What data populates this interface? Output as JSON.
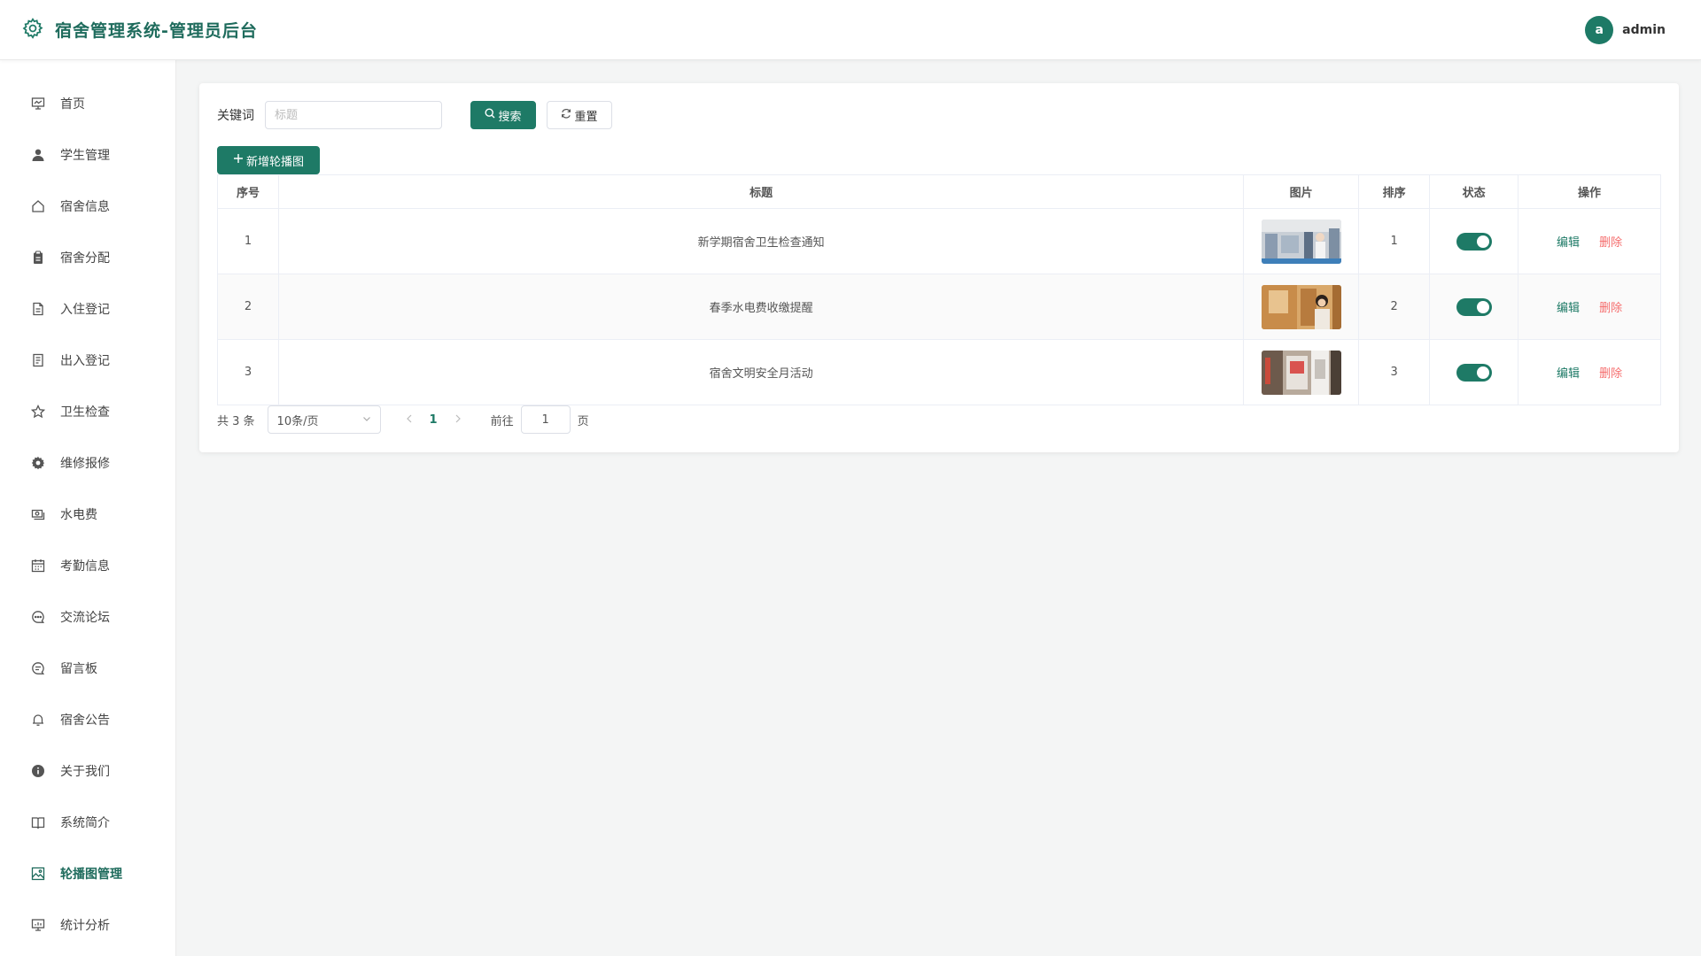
{
  "header": {
    "title": "宿舍管理系统-管理员后台",
    "avatar_letter": "a",
    "username": "admin"
  },
  "sidebar": {
    "items": [
      {
        "label": "首页",
        "icon": "presentation-icon"
      },
      {
        "label": "学生管理",
        "icon": "user-icon"
      },
      {
        "label": "宿舍信息",
        "icon": "home-icon"
      },
      {
        "label": "宿舍分配",
        "icon": "clipboard-icon"
      },
      {
        "label": "入住登记",
        "icon": "document-icon"
      },
      {
        "label": "出入登记",
        "icon": "tickets-icon"
      },
      {
        "label": "卫生检查",
        "icon": "star-icon"
      },
      {
        "label": "维修报修",
        "icon": "gear-icon"
      },
      {
        "label": "水电费",
        "icon": "money-icon"
      },
      {
        "label": "考勤信息",
        "icon": "calendar-icon"
      },
      {
        "label": "交流论坛",
        "icon": "chat-dots-icon"
      },
      {
        "label": "留言板",
        "icon": "chat-icon"
      },
      {
        "label": "宿舍公告",
        "icon": "bell-icon"
      },
      {
        "label": "关于我们",
        "icon": "info-icon"
      },
      {
        "label": "系统简介",
        "icon": "book-icon"
      },
      {
        "label": "轮播图管理",
        "icon": "picture-icon",
        "active": true
      },
      {
        "label": "统计分析",
        "icon": "data-board-icon"
      }
    ]
  },
  "search": {
    "label": "关键词",
    "placeholder": "标题",
    "value": "",
    "search_button": "搜索",
    "reset_button": "重置"
  },
  "add_button": "新增轮播图",
  "table": {
    "headers": [
      "序号",
      "标题",
      "图片",
      "排序",
      "状态",
      "操作"
    ],
    "rows": [
      {
        "index": "1",
        "title": "新学期宿舍卫生检查通知",
        "sort": "1",
        "enabled": true
      },
      {
        "index": "2",
        "title": "春季水电费收缴提醒",
        "sort": "2",
        "enabled": true
      },
      {
        "index": "3",
        "title": "宿舍文明安全月活动",
        "sort": "3",
        "enabled": true
      }
    ],
    "edit_label": "编辑",
    "delete_label": "删除"
  },
  "pagination": {
    "total_text": "共 3 条",
    "page_size": "10条/页",
    "current_page": "1",
    "goto_label": "前往",
    "goto_value": "1",
    "page_suffix": "页"
  },
  "colors": {
    "primary": "#1e7a66",
    "danger": "#f56c6c",
    "brand_text": "#1e6b5c"
  }
}
